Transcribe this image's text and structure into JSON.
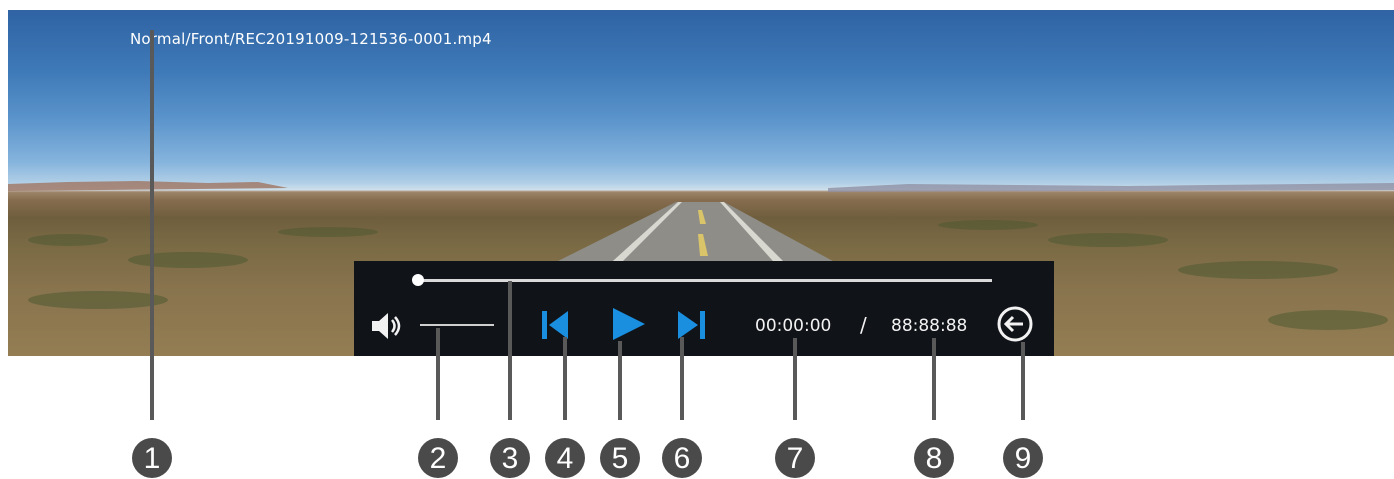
{
  "player": {
    "filename": "Normal/Front/REC20191009-121536-0001.mp4",
    "progress": 0.0,
    "volume_icon": "speaker-icon",
    "prev_icon": "skip-previous-icon",
    "play_icon": "play-icon",
    "next_icon": "skip-next-icon",
    "back_icon": "back-arrow-circle-icon",
    "current_time": "00:00:00",
    "separator": "/",
    "total_time": "88:88:88",
    "accent_color": "#1a8fe0"
  },
  "callouts": [
    "1",
    "2",
    "3",
    "4",
    "5",
    "6",
    "7",
    "8",
    "9"
  ]
}
